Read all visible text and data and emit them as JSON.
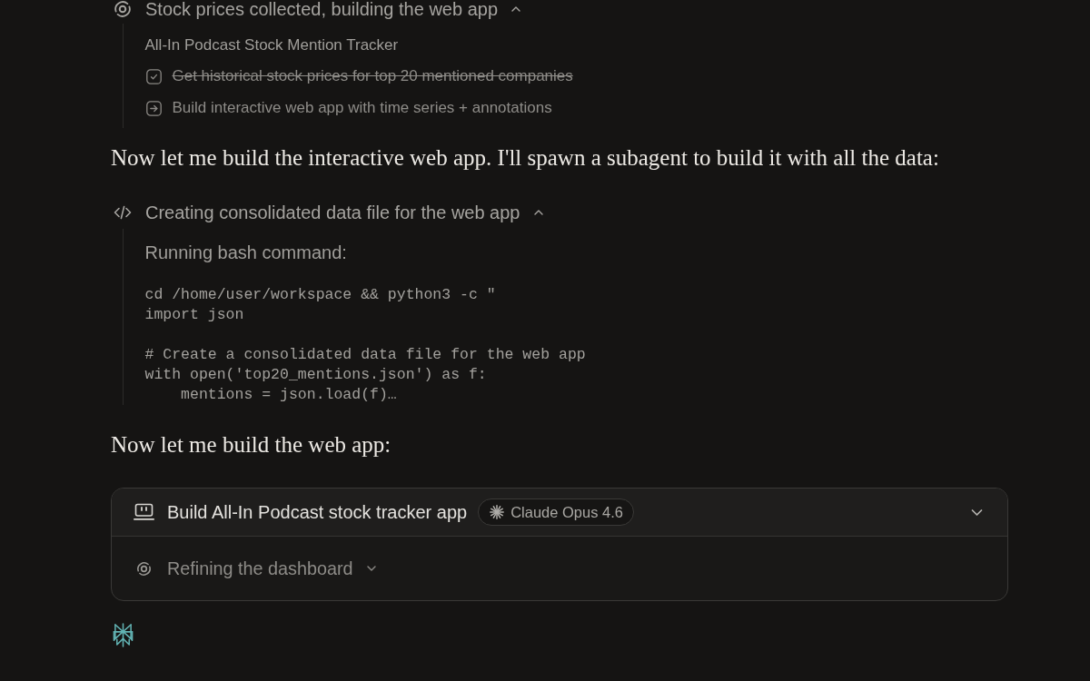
{
  "feed": [
    {
      "kind": "status_step",
      "title": "Stock prices collected, building the web app",
      "expanded": true,
      "subtitle": "All-In Podcast Stock Mention Tracker",
      "todos": [
        {
          "label": "Get historical stock prices for top 20 mentioned companies",
          "done": true
        },
        {
          "label": "Build interactive web app with time series + annotations",
          "done": false
        }
      ]
    },
    {
      "kind": "message",
      "text": "Now let me build the interactive web app. I'll spawn a subagent to build it with all the data:"
    },
    {
      "kind": "tool_step",
      "title": "Creating consolidated data file for the web app",
      "expanded": true,
      "subtitle": "Running bash command:",
      "code": "cd /home/user/workspace && python3 -c \"\nimport json\n\n# Create a consolidated data file for the web app\nwith open('top20_mentions.json') as f:\n    mentions = json.load(f)…"
    },
    {
      "kind": "message",
      "text": "Now let me build the web app:"
    },
    {
      "kind": "task_card",
      "title": "Build All-In Podcast stock tracker app",
      "model": "Claude Opus 4.6",
      "expanded": false,
      "activity": {
        "title": "Refining the dashboard",
        "expanded": false
      }
    }
  ]
}
